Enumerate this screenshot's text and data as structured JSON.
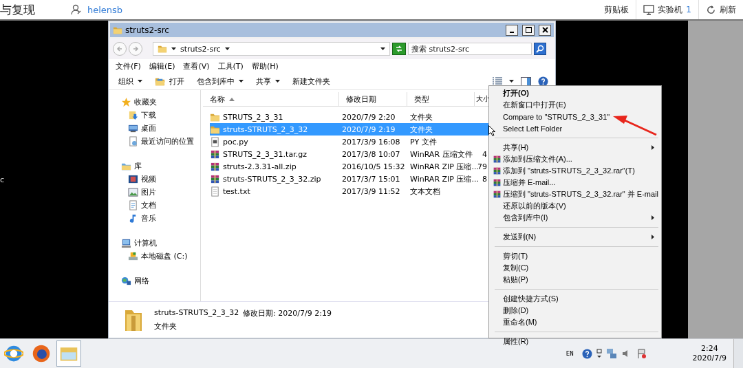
{
  "web_bar": {
    "title": "与复现",
    "user": "helensb",
    "actions": [
      {
        "kind": "text",
        "label": "剪贴板"
      },
      {
        "kind": "monitor",
        "label": "实验机",
        "count": "1"
      },
      {
        "kind": "refresh",
        "label": "刷新"
      }
    ]
  },
  "remote_edge_text": "c",
  "window": {
    "title": "struts2-src",
    "address": "struts2-src",
    "search_placeholder": "搜索 struts2-src",
    "menus": [
      "文件(F)",
      "编辑(E)",
      "查看(V)",
      "工具(T)",
      "帮助(H)"
    ],
    "toolbar": [
      {
        "label": "组织",
        "dropdown": true
      },
      {
        "label": "打开",
        "dropdown": false
      },
      {
        "label": "包含到库中",
        "dropdown": true
      },
      {
        "label": "共享",
        "dropdown": true
      },
      {
        "label": "新建文件夹",
        "dropdown": false
      }
    ],
    "sidebar": [
      {
        "label": "收藏夹",
        "kind": "star",
        "children": [
          {
            "label": "下载",
            "kind": "download"
          },
          {
            "label": "桌面",
            "kind": "desktop"
          },
          {
            "label": "最近访问的位置",
            "kind": "recent"
          }
        ]
      },
      {
        "label": "库",
        "kind": "library",
        "children": [
          {
            "label": "视频",
            "kind": "video"
          },
          {
            "label": "图片",
            "kind": "picture"
          },
          {
            "label": "文档",
            "kind": "document"
          },
          {
            "label": "音乐",
            "kind": "music"
          }
        ]
      },
      {
        "label": "计算机",
        "kind": "computer",
        "children": [
          {
            "label": "本地磁盘 (C:)",
            "kind": "disk"
          }
        ]
      },
      {
        "label": "网络",
        "kind": "network"
      }
    ],
    "columns": [
      {
        "label": "名称",
        "sorted": true
      },
      {
        "label": "修改日期",
        "sorted": false
      },
      {
        "label": "类型",
        "sorted": false
      },
      {
        "label": "大小",
        "sorted": false
      }
    ],
    "files": [
      {
        "name": "STRUTS_2_3_31",
        "kind": "folder",
        "date": "2020/7/9 2:20",
        "type": "文件夹",
        "selected": false
      },
      {
        "name": "struts-STRUTS_2_3_32",
        "kind": "folder",
        "date": "2020/7/9 2:19",
        "type": "文件夹",
        "selected": true
      },
      {
        "name": "poc.py",
        "kind": "py",
        "date": "2017/3/9 16:08",
        "type": "PY 文件",
        "selected": false
      },
      {
        "name": "STRUTS_2_3_31.tar.gz",
        "kind": "archive",
        "date": "2017/3/8 10:07",
        "type": "WinRAR 压缩文件",
        "size": "4",
        "selected": false
      },
      {
        "name": "struts-2.3.31-all.zip",
        "kind": "archive",
        "date": "2016/10/5 15:32",
        "type": "WinRAR ZIP 压缩...",
        "size": "79",
        "selected": false
      },
      {
        "name": "struts-STRUTS_2_3_32.zip",
        "kind": "archive",
        "date": "2017/3/7 15:01",
        "type": "WinRAR ZIP 压缩...",
        "size": "8",
        "selected": false
      },
      {
        "name": "test.txt",
        "kind": "text",
        "date": "2017/3/9 11:52",
        "type": "文本文档",
        "selected": false
      }
    ],
    "details": {
      "name": "struts-STRUTS_2_3_32",
      "meta": "修改日期: 2020/7/9 2:19",
      "type": "文件夹"
    }
  },
  "context_menu": {
    "groups": [
      [
        {
          "label": "打开(O)",
          "kind": "plain",
          "default": true,
          "submenu": false
        },
        {
          "label": "在新窗口中打开(E)",
          "kind": "plain",
          "default": false,
          "submenu": false
        },
        {
          "label": "Compare to \"STRUTS_2_3_31\"",
          "kind": "plain",
          "default": false,
          "submenu": false
        },
        {
          "label": "Select Left Folder",
          "kind": "plain",
          "default": false,
          "submenu": false
        }
      ],
      [
        {
          "label": "共享(H)",
          "kind": "plain",
          "default": false,
          "submenu": true
        },
        {
          "label": "添加到压缩文件(A)...",
          "kind": "archive",
          "default": false,
          "submenu": false
        },
        {
          "label": "添加到 \"struts-STRUTS_2_3_32.rar\"(T)",
          "kind": "archive",
          "default": false,
          "submenu": false
        },
        {
          "label": "压缩并 E-mail...",
          "kind": "archive",
          "default": false,
          "submenu": false
        },
        {
          "label": "压缩到 \"struts-STRUTS_2_3_32.rar\" 并 E-mail",
          "kind": "archive",
          "default": false,
          "submenu": false
        },
        {
          "label": "还原以前的版本(V)",
          "kind": "plain",
          "default": false,
          "submenu": false
        },
        {
          "label": "包含到库中(I)",
          "kind": "plain",
          "default": false,
          "submenu": true
        }
      ],
      [
        {
          "label": "发送到(N)",
          "kind": "plain",
          "default": false,
          "submenu": true
        }
      ],
      [
        {
          "label": "剪切(T)",
          "kind": "plain",
          "default": false,
          "submenu": false
        },
        {
          "label": "复制(C)",
          "kind": "plain",
          "default": false,
          "submenu": false
        },
        {
          "label": "粘贴(P)",
          "kind": "plain",
          "default": false,
          "submenu": false
        }
      ],
      [
        {
          "label": "创建快捷方式(S)",
          "kind": "plain",
          "default": false,
          "submenu": false
        },
        {
          "label": "删除(D)",
          "kind": "plain",
          "default": false,
          "submenu": false
        },
        {
          "label": "重命名(M)",
          "kind": "plain",
          "default": false,
          "submenu": false
        }
      ],
      [
        {
          "label": "属性(R)",
          "kind": "plain",
          "default": false,
          "submenu": false
        }
      ]
    ]
  },
  "taskbar": {
    "apps": [
      {
        "kind": "ie",
        "selected": false
      },
      {
        "kind": "firefox",
        "selected": false
      },
      {
        "kind": "explorer",
        "selected": true
      }
    ],
    "language": "EN",
    "time": "2:24",
    "date": "2020/7/9"
  }
}
